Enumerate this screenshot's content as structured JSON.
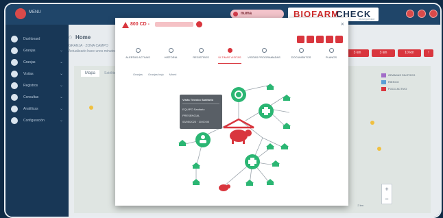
{
  "header": {
    "menu_label": "MENU",
    "user_pill": "numa",
    "brand_left": "BIOFARM",
    "brand_right": "CHECK",
    "brand_tag": "bioseguridad"
  },
  "sidebar": {
    "items": [
      {
        "label": "Dashboard",
        "chevron": ""
      },
      {
        "label": "Granjas",
        "chevron": "⌄"
      },
      {
        "label": "Granjas",
        "chevron": "⌄"
      },
      {
        "label": "Visitas",
        "chevron": "⌄"
      },
      {
        "label": "Registros",
        "chevron": "⌄"
      },
      {
        "label": "Consultas",
        "chevron": "⌄"
      },
      {
        "label": "Analíticas",
        "chevron": "⌄"
      },
      {
        "label": "Configuración",
        "chevron": "⌄"
      }
    ]
  },
  "main": {
    "home_title": "Home",
    "home_sub1": "GRANJA · ZONA CAMPO",
    "home_sub2": "Actualizado hace unos minutos",
    "map_tab": "Mapa",
    "map_tab2": "Satélite",
    "red_buttons": [
      "3 km",
      "3 km",
      "10 km"
    ],
    "legend": [
      {
        "label": "GRANJAS SIN FOCO",
        "color": "#a26cc8"
      },
      {
        "label": "RIESGO",
        "color": "#5a9fd6"
      },
      {
        "label": "FOCO ACTIVO",
        "color": "#d9363e"
      }
    ],
    "scale_text": "2 km",
    "zoom_in": "+",
    "zoom_out": "−"
  },
  "modal": {
    "title": "800 CD -",
    "close": "×",
    "tabs": [
      {
        "label": "ALERTAS ACTIVAS",
        "active": false
      },
      {
        "label": "HISTORIA",
        "active": false
      },
      {
        "label": "REGISTROS",
        "active": false
      },
      {
        "label": "ÚLTIMAS VISITAS",
        "active": true
      },
      {
        "label": "VISITAS PROGRAMADAS",
        "active": false
      },
      {
        "label": "DOCUMENTOS",
        "active": false
      },
      {
        "label": "PLANOS",
        "active": false
      }
    ],
    "filters": [
      "Granjas",
      "Granjas bajo",
      "Mixed"
    ],
    "tooltip": {
      "heading": "Visita Técnico Sanitario",
      "lines": [
        "EQUIPO Sanitario",
        "PRESENCIAL",
        "03/05/2023 · 10:00:00"
      ]
    }
  },
  "colors": {
    "accent": "#d9363e",
    "node_green": "#2bb673",
    "sidebar": "#183756"
  }
}
